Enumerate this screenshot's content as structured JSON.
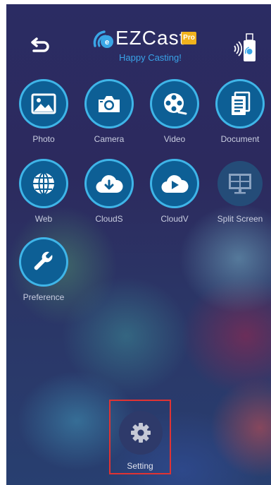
{
  "header": {
    "logo_text": "EZCast",
    "logo_badge": "Pro",
    "tagline": "Happy Casting!"
  },
  "menu": {
    "items": [
      {
        "label": "Photo",
        "icon": "photo-icon"
      },
      {
        "label": "Camera",
        "icon": "camera-icon"
      },
      {
        "label": "Video",
        "icon": "video-reel-icon"
      },
      {
        "label": "Document",
        "icon": "document-icon"
      },
      {
        "label": "Web",
        "icon": "globe-icon"
      },
      {
        "label": "CloudS",
        "icon": "cloud-download-icon"
      },
      {
        "label": "CloudV",
        "icon": "cloud-play-icon"
      },
      {
        "label": "Split Screen",
        "icon": "split-screen-icon"
      },
      {
        "label": "Preference",
        "icon": "wrench-icon"
      }
    ]
  },
  "setting": {
    "label": "Setting",
    "icon": "gear-icon"
  },
  "colors": {
    "accent": "#3fb5e8",
    "circle": "#0d5f95",
    "highlight": "#e03333",
    "badge": "#f0b21d"
  }
}
